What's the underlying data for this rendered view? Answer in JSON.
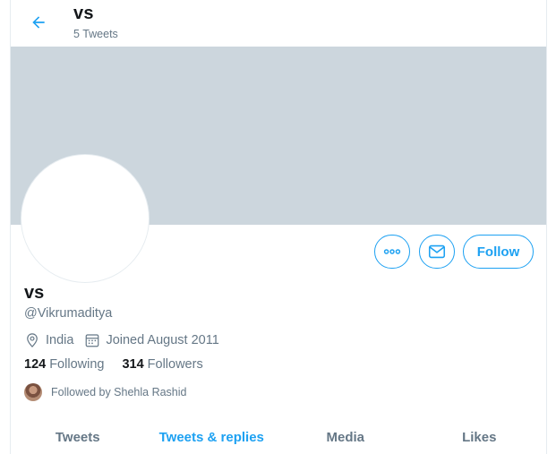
{
  "header": {
    "title": "vs",
    "subtitle": "5 Tweets"
  },
  "profile": {
    "name": "vs",
    "handle": "@Vikrumaditya",
    "location": "India",
    "joined": "Joined August 2011",
    "following_count": "124",
    "following_label": "Following",
    "followers_count": "314",
    "followers_label": "Followers",
    "followed_by": "Followed by Shehla Rashid"
  },
  "actions": {
    "follow_label": "Follow",
    "more_icon": "more-icon",
    "message_icon": "mail-icon"
  },
  "tabs": [
    {
      "label": "Tweets",
      "active": false
    },
    {
      "label": "Tweets & replies",
      "active": true
    },
    {
      "label": "Media",
      "active": false
    },
    {
      "label": "Likes",
      "active": false
    }
  ],
  "colors": {
    "accent": "#1da1f2",
    "banner": "#ccd6dd",
    "secondary_text": "#657786",
    "primary_text": "#14171a"
  }
}
